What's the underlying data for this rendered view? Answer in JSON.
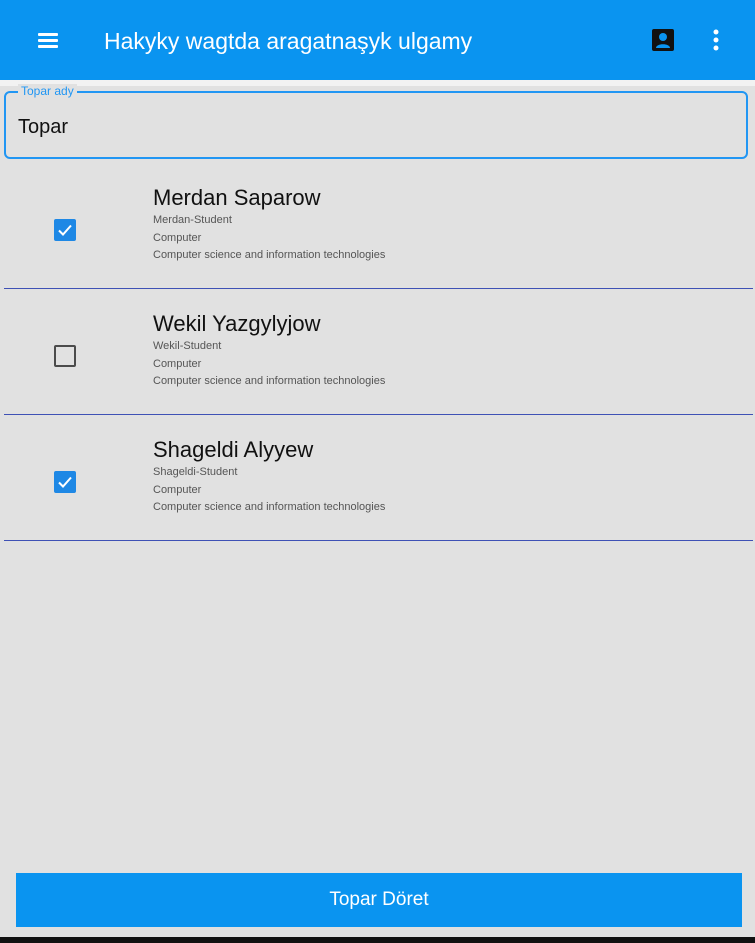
{
  "appbar": {
    "title": "Hakyky wagtda aragatnaşyk ulgamy",
    "icons": {
      "menu": "menu-icon",
      "contact": "contact-card-icon",
      "more": "more-vert-icon"
    }
  },
  "group_name": {
    "label": "Topar ady",
    "value": "Topar"
  },
  "students": [
    {
      "name": "Merdan Saparow",
      "username": "Merdan-Student",
      "department": "Computer",
      "faculty": "Computer science and information technologies",
      "checked": true
    },
    {
      "name": "Wekil Yazgylyjow",
      "username": "Wekil-Student",
      "department": "Computer",
      "faculty": "Computer science and information technologies",
      "checked": false
    },
    {
      "name": "Shageldi Alyyew",
      "username": "Shageldi-Student",
      "department": "Computer",
      "faculty": "Computer science and information technologies",
      "checked": true
    }
  ],
  "actions": {
    "create_group": "Topar Döret"
  },
  "colors": {
    "primary": "#0a94f0",
    "accent": "#2196f3",
    "divider": "#3f51b5",
    "background": "#e1e1e1"
  }
}
